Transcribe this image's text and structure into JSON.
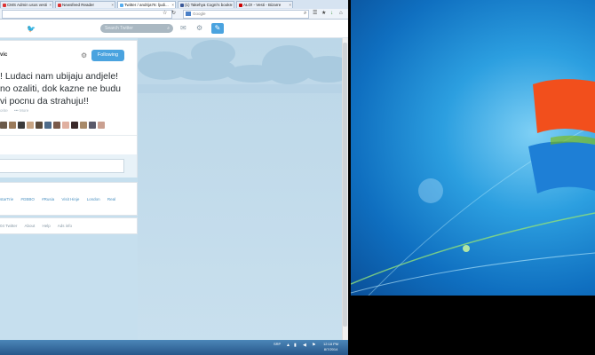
{
  "browser": {
    "tabs": [
      {
        "label": "CMS Admin usos vesti",
        "icon_color": "#d33"
      },
      {
        "label": "Newsfeed Reader",
        "icon_color": "#d33"
      },
      {
        "label": "Twitter / andrija76: ljudi...",
        "icon_color": "#55acee"
      },
      {
        "label": "(1) Takehya Cogni's books",
        "icon_color": "#3b5998"
      },
      {
        "label": "ALO! - Vesti - Bizarre",
        "icon_color": "#c00"
      }
    ],
    "search_placeholder": "Google",
    "url_icon": "bookmark-star-icon"
  },
  "twitter": {
    "search_placeholder": "Search Twitter",
    "user_fragment": "vic",
    "follow_label": "Following",
    "tweet_lines": [
      "! Ludaci nam ubijaju andjele!",
      "no ozaliti, dok kazne ne budu",
      "vi pocnu da strahuju!!"
    ],
    "actions": [
      "orite",
      "More"
    ],
    "avatar_colors": [
      "#6b5a4a",
      "#9a7a5a",
      "#3a3a3a",
      "#c7a483",
      "#5a4a3a",
      "#4d6b8a",
      "#7a5a4a",
      "#e0b0a0",
      "#3a2a2a",
      "#a88a6a",
      "#5a5a6a",
      "#caa090"
    ],
    "trends": [
      "starTrie",
      "#GBBO",
      "#Rusia",
      "Visit Hinje",
      "London",
      "Real"
    ],
    "footer_links": [
      "04 Twitter",
      "About",
      "Help",
      "Ads info"
    ]
  },
  "taskbar": {
    "tray": "SRP",
    "time": "12:18 PM",
    "date": "8/7/2014"
  },
  "colors": {
    "twitter_blue": "#55acee",
    "follow_button": "#4aa3df",
    "win7_desktop": "#2c9fe0"
  }
}
